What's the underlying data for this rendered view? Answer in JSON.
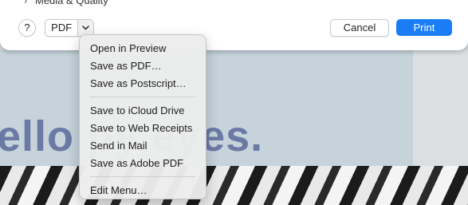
{
  "dialog": {
    "partial_row_label": "Media & Quality",
    "help_label": "?",
    "pdf_label": "PDF",
    "cancel_label": "Cancel",
    "print_label": "Print"
  },
  "background": {
    "headline_text": "ello          py eyes."
  },
  "pdf_menu": {
    "group1": [
      "Open in Preview",
      "Save as PDF…",
      "Save as Postscript…"
    ],
    "group2": [
      "Save to iCloud Drive",
      "Save to Web Receipts",
      "Send in Mail",
      "Save as Adobe PDF"
    ],
    "group3": [
      "Edit Menu…"
    ]
  },
  "colors": {
    "accent": "#1a7df5",
    "headline": "#6b79a5"
  }
}
